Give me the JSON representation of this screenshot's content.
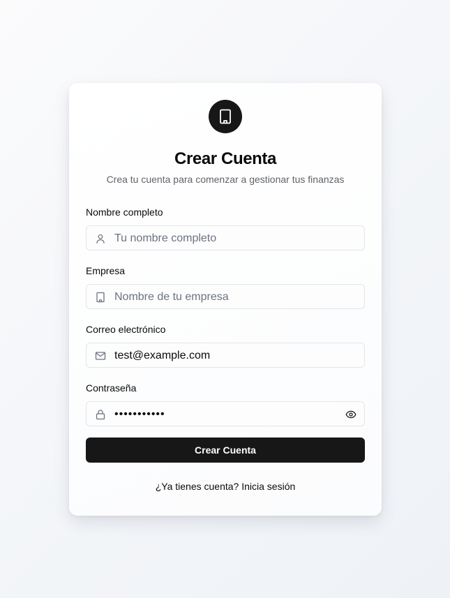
{
  "header": {
    "logo_icon": "building-icon",
    "title": "Crear Cuenta",
    "subtitle": "Crea tu cuenta para comenzar a gestionar tus finanzas"
  },
  "form": {
    "full_name": {
      "label": "Nombre completo",
      "placeholder": "Tu nombre completo",
      "value": "",
      "icon": "user-icon"
    },
    "company": {
      "label": "Empresa",
      "placeholder": "Nombre de tu empresa",
      "value": "",
      "icon": "building-icon"
    },
    "email": {
      "label": "Correo electrónico",
      "placeholder": "",
      "value": "test@example.com",
      "icon": "mail-icon"
    },
    "password": {
      "label": "Contraseña",
      "masked_value": "•••••••••••",
      "icon": "lock-icon",
      "toggle_icon": "eye-icon"
    },
    "submit_label": "Crear Cuenta"
  },
  "footer": {
    "login_link": "¿Ya tienes cuenta? Inicia sesión"
  },
  "colors": {
    "primary": "#171717",
    "muted_text": "#5f6368",
    "border": "#e3e5e8",
    "background": "#f4f6f9"
  }
}
